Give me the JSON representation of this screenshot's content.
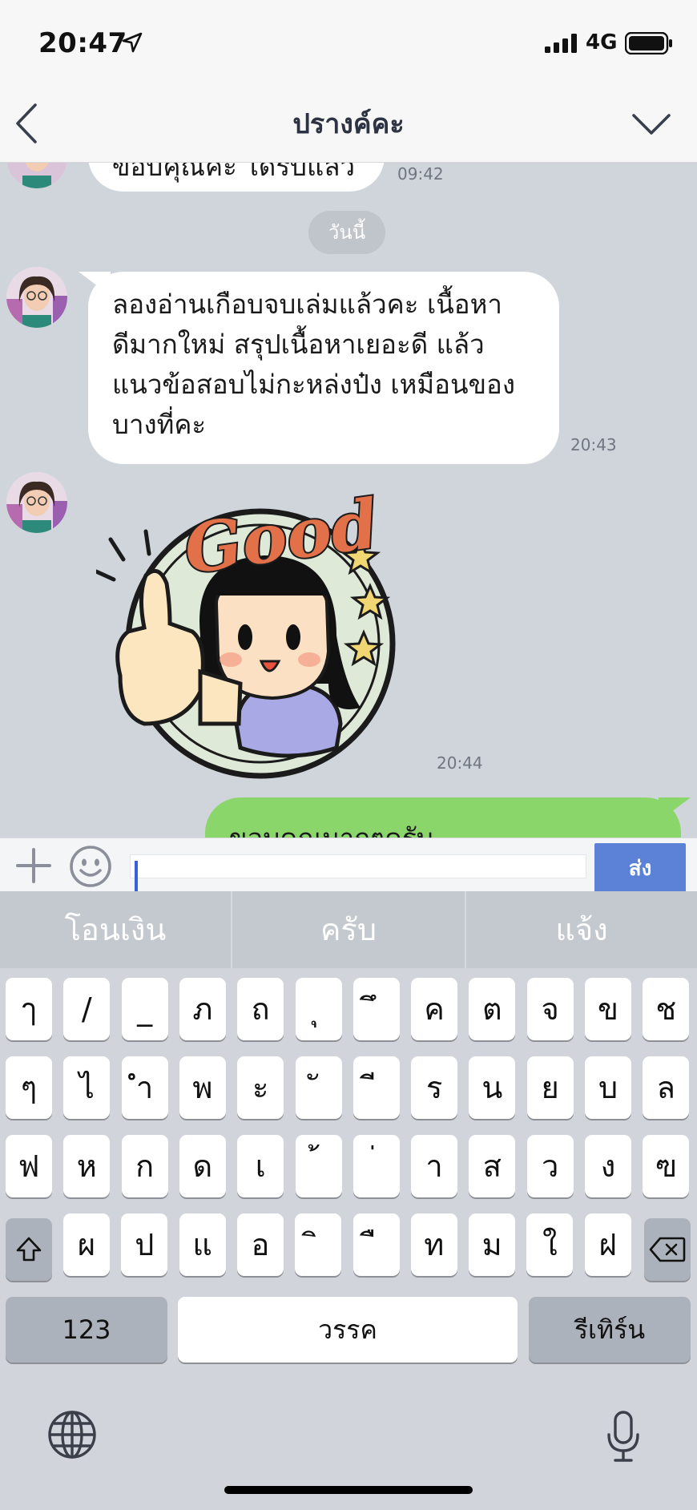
{
  "status_bar": {
    "time": "20:47",
    "network": "4G",
    "icons": [
      "location-arrow-icon",
      "signal-icon",
      "battery-icon"
    ]
  },
  "header": {
    "title": "ปรางค์คะ",
    "back_icon": "chevron-left-icon",
    "menu_icon": "chevron-down-icon"
  },
  "chat": {
    "prev_message": {
      "text": "ขอบคุณคะ ได้รับแล้ว",
      "time": "09:42"
    },
    "date_separator": "วันนี้",
    "messages": [
      {
        "direction": "in",
        "lines": [
          "ลองอ่านเกือบจบเล่มแล้วคะ  เนื้อหา",
          "ดีมากใหม่ สรุปเนื้อหาเยอะดี แล้ว",
          "แนวข้อสอบไม่กะหล่งป๋ง เหมือนของ",
          "บางที่คะ"
        ],
        "time": "20:43"
      },
      {
        "direction": "in",
        "sticker_text": "Good",
        "time": "20:44"
      },
      {
        "direction": "out",
        "text": "ขอบคุณมากๆครับ"
      }
    ]
  },
  "input": {
    "value": "",
    "send_label": "ส่ง"
  },
  "keyboard": {
    "suggestions": [
      "โอนเงิน",
      "ครับ",
      "แจ้ง"
    ],
    "rows": [
      [
        "ๅ",
        "/",
        "_",
        "ภ",
        "ถ",
        "ุ",
        "ึ",
        "ค",
        "ต",
        "จ",
        "ข",
        "ช"
      ],
      [
        "ๆ",
        "ไ",
        "ำ",
        "พ",
        "ะ",
        "ั",
        "ี",
        "ร",
        "น",
        "ย",
        "บ",
        "ล"
      ],
      [
        "ฟ",
        "ห",
        "ก",
        "ด",
        "เ",
        "้",
        "่",
        "า",
        "ส",
        "ว",
        "ง",
        "ฃ"
      ],
      [
        "ผ",
        "ป",
        "แ",
        "อ",
        "ิ",
        "ื",
        "ท",
        "ม",
        "ใ",
        "ฝ"
      ]
    ],
    "numbers_label": "123",
    "space_label": "วรรค",
    "return_label": "รีเทิร์น"
  }
}
